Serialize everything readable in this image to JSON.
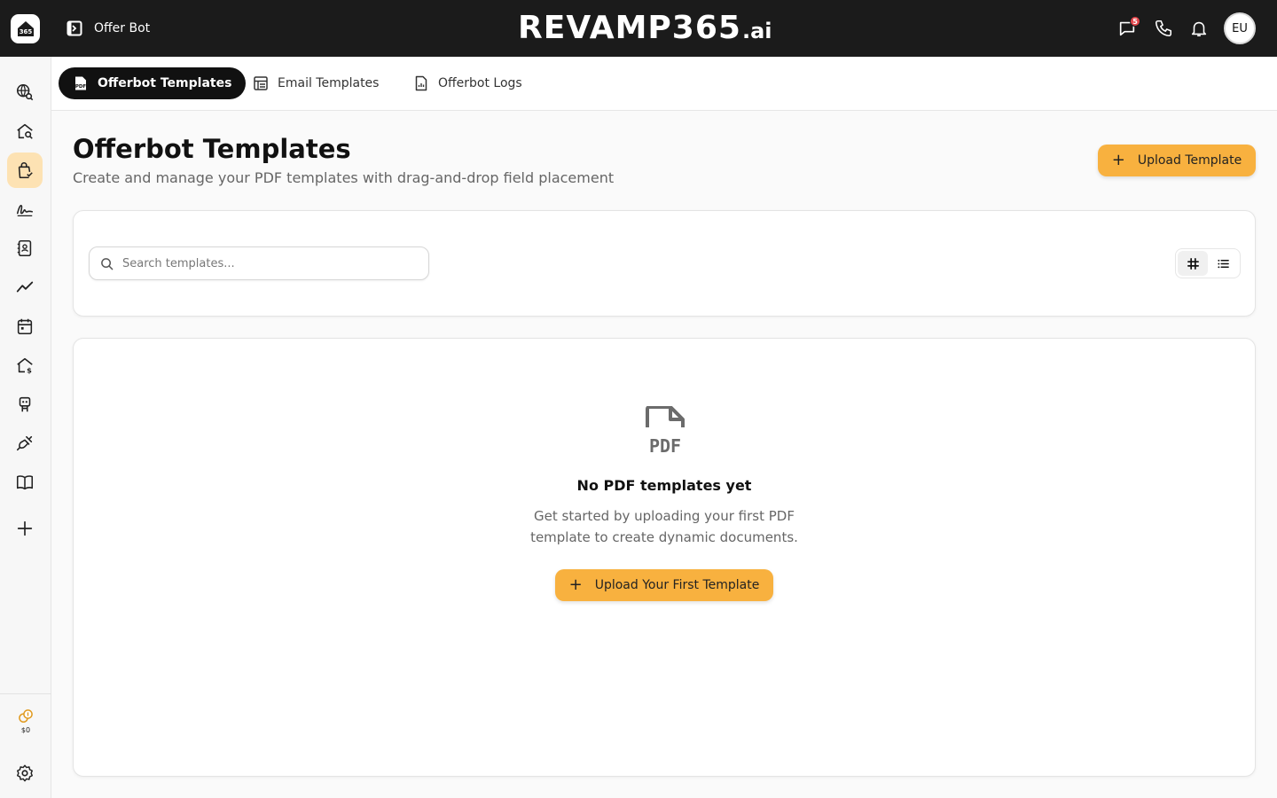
{
  "topbar": {
    "crumb": "Offer Bot",
    "brand_main": "REVAMP365",
    "brand_tld": ".ai",
    "chat_badge_count": "5",
    "avatar_initials": "EU",
    "icons": [
      "chat-icon",
      "phone-icon",
      "bell-icon"
    ]
  },
  "sidebar": {
    "items": [
      "globe-search-icon",
      "home-search-icon",
      "offer-bag-icon",
      "signature-icon",
      "contact-book-icon",
      "analytics-icon",
      "calendar-icon",
      "home-dollar-icon",
      "robot-icon",
      "plug-icon",
      "book-icon",
      "add-icon"
    ],
    "active_index": 2,
    "credit_amount": "$0"
  },
  "tabs": [
    {
      "label": "Offerbot Templates",
      "icon": "pdf-file-icon",
      "active": true
    },
    {
      "label": "Email Templates",
      "icon": "template-icon",
      "active": false
    },
    {
      "label": "Offerbot Logs",
      "icon": "log-file-icon",
      "active": false
    }
  ],
  "header": {
    "title": "Offerbot Templates",
    "subtitle": "Create and manage your PDF templates with drag-and-drop field placement",
    "upload_label": "Upload Template"
  },
  "search": {
    "placeholder": "Search templates...",
    "value": ""
  },
  "view_toggle": {
    "active": "grid"
  },
  "empty_state": {
    "title": "No PDF templates yet",
    "desc_line1": "Get started by uploading your first PDF",
    "desc_line2": "template to create dynamic documents.",
    "button_label": "Upload Your First Template"
  },
  "colors": {
    "accent": "#f8b13f",
    "topbar": "#1b1b1b",
    "active_nav": "#fde2b3"
  }
}
